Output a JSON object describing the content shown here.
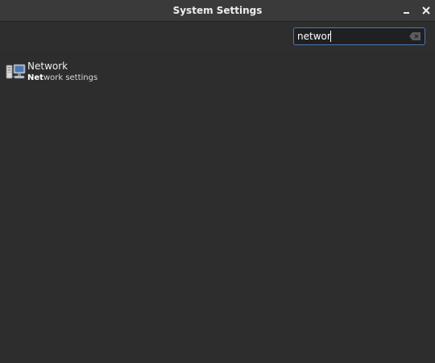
{
  "window": {
    "title": "System Settings"
  },
  "search": {
    "value": "networ",
    "placeholder": ""
  },
  "results": [
    {
      "title": "Network",
      "description_highlight": "Net",
      "description_rest": "work settings",
      "icon": "network-icon"
    }
  ],
  "colors": {
    "titlebar": "#3a3a3a",
    "background": "#2d2d2d",
    "search_border": "#4a78b3",
    "text": "#eeeeec"
  }
}
